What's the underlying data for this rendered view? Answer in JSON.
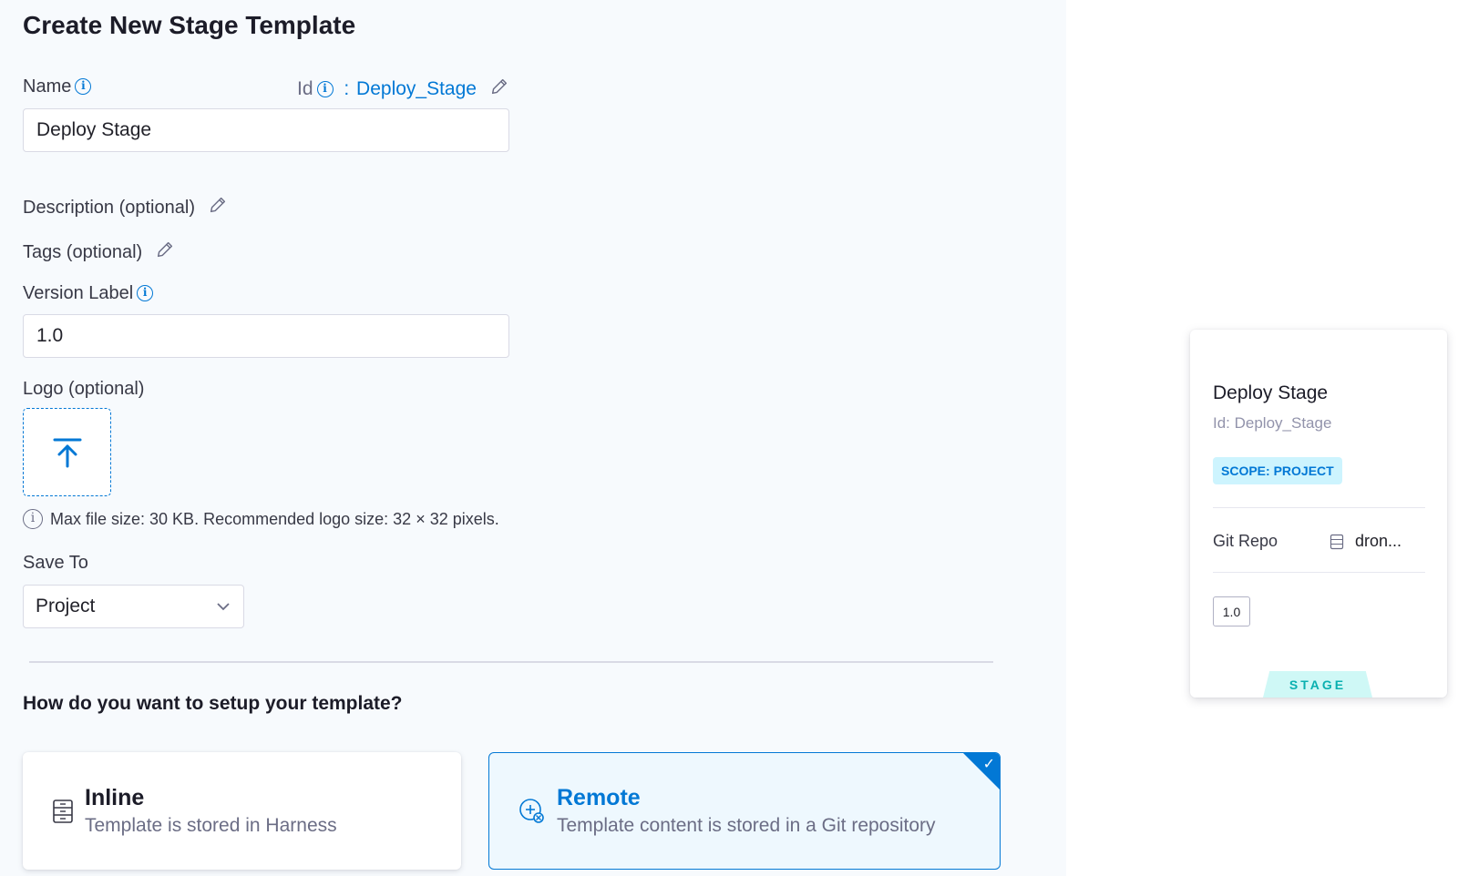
{
  "title": "Create New Stage Template",
  "name_field": {
    "label": "Name",
    "value": "Deploy Stage"
  },
  "id_field": {
    "label": "Id",
    "separator": ":",
    "value": "Deploy_Stage"
  },
  "description": {
    "label": "Description (optional)"
  },
  "tags": {
    "label": "Tags (optional)"
  },
  "version": {
    "label": "Version Label",
    "value": "1.0"
  },
  "logo": {
    "label": "Logo (optional)",
    "hint": "Max file size: 30 KB. Recommended logo size: 32 × 32 pixels."
  },
  "save_to": {
    "label": "Save To",
    "value": "Project"
  },
  "setup": {
    "question": "How do you want to setup your template?",
    "options": [
      {
        "title": "Inline",
        "subtitle": "Template is stored in Harness",
        "selected": false
      },
      {
        "title": "Remote",
        "subtitle": "Template content is stored in a Git repository",
        "selected": true
      }
    ]
  },
  "preview": {
    "name": "Deploy Stage",
    "id_text": "Id: Deploy_Stage",
    "scope": "SCOPE: PROJECT",
    "git_label": "Git Repo",
    "git_value": "dron...",
    "version": "1.0",
    "type": "STAGE"
  },
  "colors": {
    "accent": "#0278d5",
    "selected_bg": "#eef8fe",
    "scope_bg": "#cdf4fe",
    "stage_bg": "#cff8f6",
    "stage_text": "#0ab0b0"
  }
}
